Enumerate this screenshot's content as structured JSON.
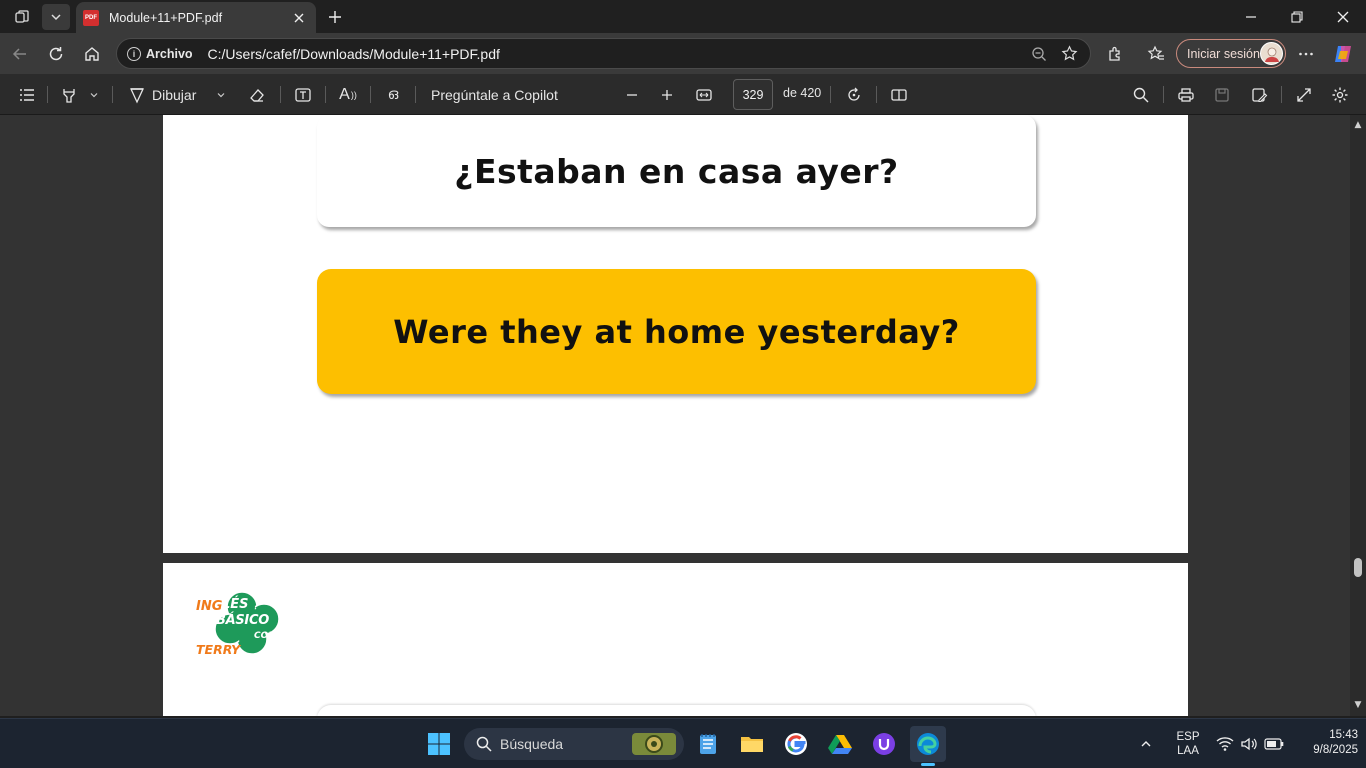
{
  "browser": {
    "tab_title": "Module+11+PDF.pdf",
    "tab_favicon_text": "PDF",
    "address_chip": "Archivo",
    "url": "C:/Users/cafef/Downloads/Module+11+PDF.pdf",
    "signin_label": "Iniciar sesión"
  },
  "pdf_toolbar": {
    "draw_label": "Dibujar",
    "copilot_label": "Pregúntale a Copilot",
    "current_page": "329",
    "page_of": "de 420",
    "read_aloud_glyph": "A",
    "translate_glyph": "ഒ"
  },
  "document": {
    "spanish_question": "¿Estaban en casa ayer?",
    "english_question": "Were they at home yesterday?",
    "logo_top": "INGLÉS",
    "logo_main": "BÁSICO",
    "logo_con": "CON",
    "logo_bottom": "TERRY"
  },
  "taskbar": {
    "search_placeholder": "Búsqueda",
    "lang_top": "ESP",
    "lang_bottom": "LAA",
    "time": "15:43",
    "date": "9/8/2025"
  },
  "colors": {
    "card_yellow": "#fdbf00",
    "logo_green": "#1e9a5a",
    "logo_orange": "#f07a1a",
    "edge_blue": "#1e88e5"
  }
}
